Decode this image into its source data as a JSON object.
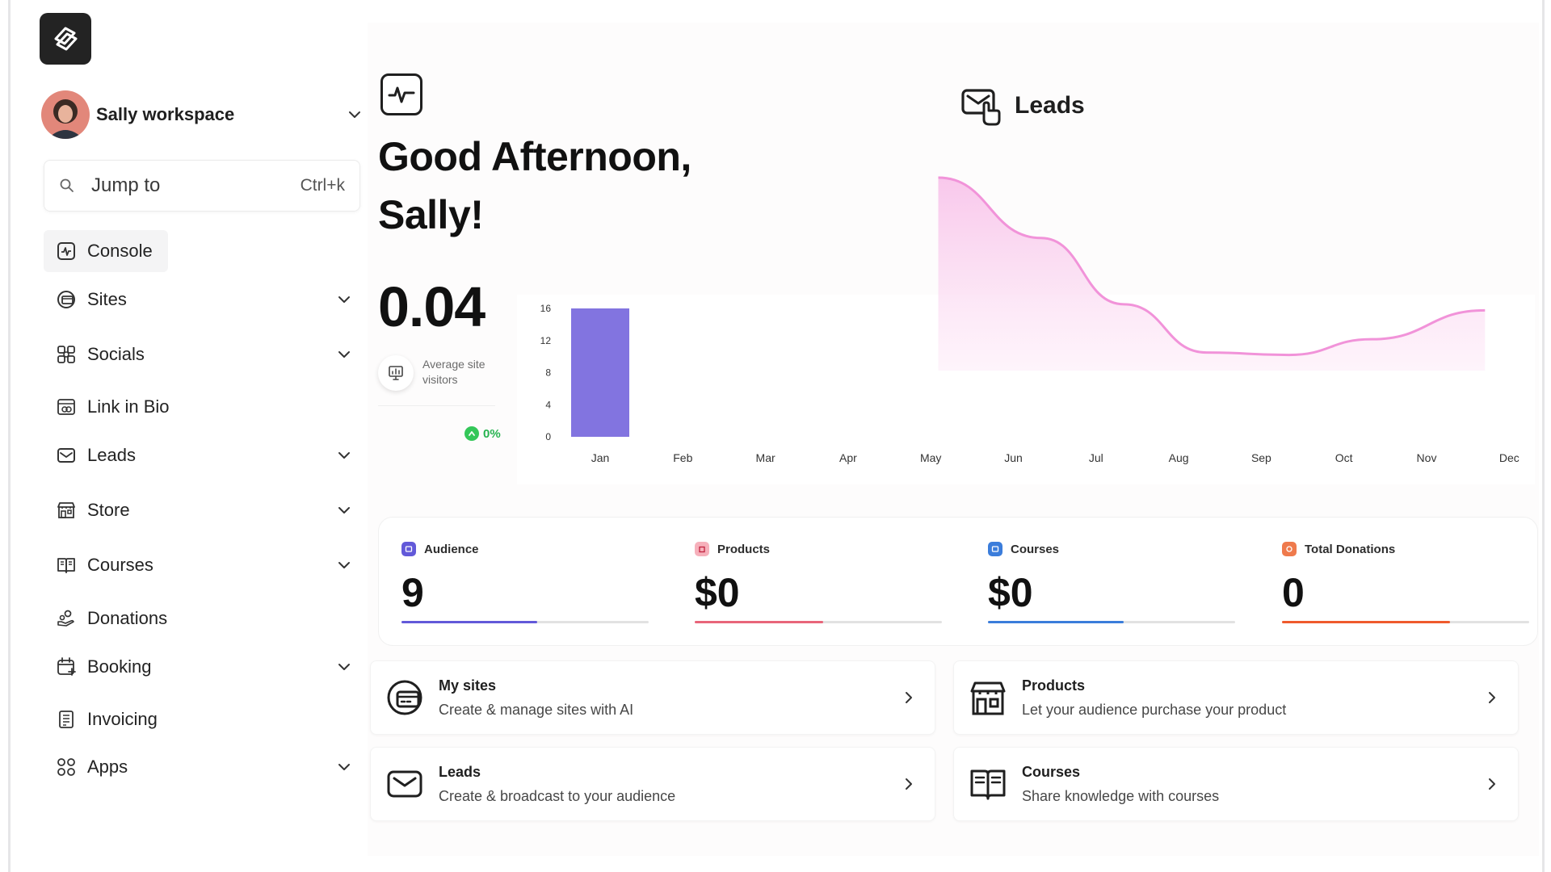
{
  "sidebar": {
    "workspace_name": "Sally workspace",
    "search": {
      "placeholder": "Jump to",
      "shortcut": "Ctrl+k"
    },
    "items": [
      {
        "label": "Console",
        "icon": "console-icon",
        "active": true,
        "expandable": false
      },
      {
        "label": "Sites",
        "icon": "globe-icon",
        "expandable": true
      },
      {
        "label": "Socials",
        "icon": "socials-icon",
        "expandable": true
      },
      {
        "label": "Link in Bio",
        "icon": "link-in-bio-icon",
        "expandable": false
      },
      {
        "label": "Leads",
        "icon": "mail-icon",
        "expandable": true
      },
      {
        "label": "Store",
        "icon": "store-icon",
        "expandable": true
      },
      {
        "label": "Courses",
        "icon": "book-icon",
        "expandable": true
      },
      {
        "label": "Donations",
        "icon": "donations-icon",
        "expandable": false
      },
      {
        "label": "Booking",
        "icon": "calendar-icon",
        "expandable": true
      },
      {
        "label": "Invoicing",
        "icon": "invoice-icon",
        "expandable": false
      },
      {
        "label": "Apps",
        "icon": "apps-icon",
        "expandable": true
      }
    ]
  },
  "dashboard": {
    "greeting_line1": "Good Afternoon,",
    "greeting_line2": "Sally!",
    "avg_visitors_value": "0.04",
    "avg_visitors_label": "Average site visitors",
    "change_pct": "0%",
    "leads_title": "Leads"
  },
  "chart_data": [
    {
      "type": "bar",
      "categories": [
        "Jan",
        "Feb",
        "Mar",
        "Apr",
        "May",
        "Jun",
        "Jul",
        "Aug",
        "Sep",
        "Oct",
        "Nov",
        "Dec"
      ],
      "values": [
        16,
        0,
        0,
        0,
        0,
        0,
        0,
        0,
        0,
        0,
        0,
        0
      ],
      "yticks": [
        0,
        4,
        8,
        12,
        16
      ],
      "ylim": [
        0,
        16
      ],
      "color": "#8274e0",
      "title": ""
    },
    {
      "type": "area",
      "categories": [
        "Jun",
        "Jul",
        "Aug",
        "Sep",
        "Oct",
        "Nov",
        "Dec"
      ],
      "values": [
        16,
        11,
        5.5,
        1.5,
        1.3,
        2.6,
        5
      ],
      "ylim": [
        0,
        16
      ],
      "color": "#f193d9",
      "title": ""
    }
  ],
  "stats": [
    {
      "label": "Audience",
      "value": "9",
      "color": "#6259d9",
      "fill": 0.55
    },
    {
      "label": "Products",
      "value": "$0",
      "color": "#e8657a",
      "fill": 0.52
    },
    {
      "label": "Courses",
      "value": "$0",
      "color": "#3b7ddb",
      "fill": 0.55
    },
    {
      "label": "Total Donations",
      "value": "0",
      "color": "#ef5a2c",
      "fill": 0.68
    }
  ],
  "cards": [
    {
      "title": "My sites",
      "subtitle": "Create & manage sites with AI",
      "icon": "globe-icon"
    },
    {
      "title": "Products",
      "subtitle": "Let your audience purchase your product",
      "icon": "store-icon"
    },
    {
      "title": "Leads",
      "subtitle": "Create & broadcast to your audience",
      "icon": "mail-icon"
    },
    {
      "title": "Courses",
      "subtitle": "Share knowledge with courses",
      "icon": "book-icon"
    }
  ]
}
